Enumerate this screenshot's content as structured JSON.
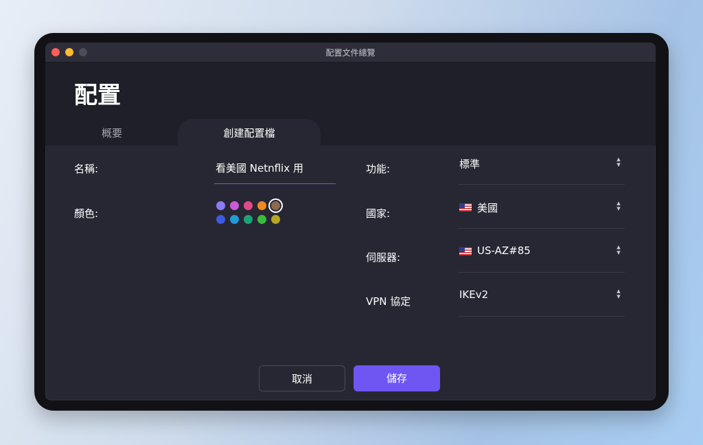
{
  "window": {
    "title": "配置文件總覽"
  },
  "page": {
    "title": "配置"
  },
  "tabs": [
    {
      "label": "概要",
      "active": false
    },
    {
      "label": "創建配置檔",
      "active": true
    }
  ],
  "form": {
    "name": {
      "label": "名稱:",
      "value": "看美國 Netnflix 用"
    },
    "color": {
      "label": "顏色:",
      "swatches": [
        "#8b7cf6",
        "#c95bd6",
        "#e04a8a",
        "#f08a1d",
        "#8b6a4f",
        "#3d5be0",
        "#1f9bd6",
        "#1aa47a",
        "#3bbd3a",
        "#b8a622"
      ],
      "selected_index": 4
    },
    "function": {
      "label": "功能:",
      "value": "標準"
    },
    "country": {
      "label": "國家:",
      "value": "美國",
      "flag": "us-flag-icon"
    },
    "server": {
      "label": "伺服器:",
      "value": "US-AZ#85",
      "flag": "us-flag-icon"
    },
    "protocol": {
      "label": "VPN 協定",
      "value": "IKEv2"
    }
  },
  "buttons": {
    "cancel": "取消",
    "save": "儲存"
  },
  "colors": {
    "accent": "#6f55f2",
    "background": "#272733",
    "header": "#1f1f29"
  }
}
